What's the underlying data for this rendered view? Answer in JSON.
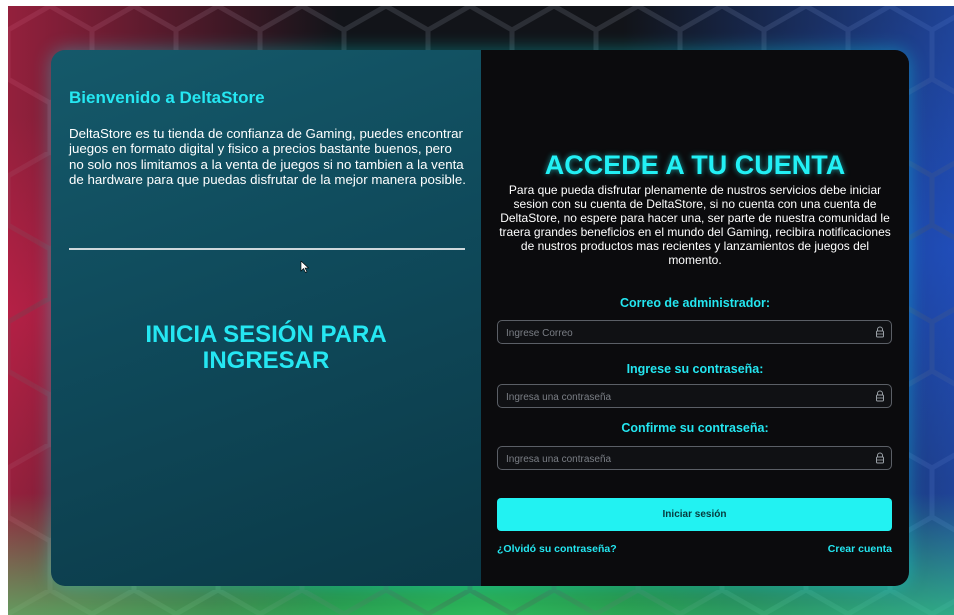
{
  "colors": {
    "accent": "#22f0f5",
    "left_panel": "#12566a",
    "right_panel": "#0b0b0d",
    "button": "#22f2f2"
  },
  "left": {
    "title": "Bienvenido a DeltaStore",
    "description": "DeltaStore es tu tienda de confianza de Gaming, puedes encontrar juegos en formato digital y fisico a precios bastante buenos, pero no solo nos limitamos a la venta de juegos si no tambien a la venta de hardware para que puedas disfrutar de la mejor manera posible.",
    "cta_line1": "INICIA SESIÓN PARA",
    "cta_line2": "INGRESAR"
  },
  "right": {
    "title": "ACCEDE A TU CUENTA",
    "description": "Para que pueda disfrutar plenamente de nustros servicios debe iniciar sesion con su cuenta de DeltaStore, si no cuenta con una cuenta de DeltaStore, no espere para hacer una, ser parte de nuestra comunidad le traera grandes beneficios en el mundo del Gaming, recibira notificaciones de nustros productos mas recientes y lanzamientos de juegos del momento.",
    "email": {
      "label": "Correo de administrador:",
      "placeholder": "Ingrese Correo",
      "icon": "lock-icon"
    },
    "password": {
      "label": "Ingrese su contraseña:",
      "placeholder": "Ingresa una contraseña",
      "icon": "lock-icon"
    },
    "confirm": {
      "label": "Confirme su contraseña:",
      "placeholder": "Ingresa una contraseña",
      "icon": "lock-icon"
    },
    "submit_label": "Iniciar sesión",
    "forgot_label": "¿Olvidó su contraseña?",
    "create_label": "Crear cuenta"
  }
}
